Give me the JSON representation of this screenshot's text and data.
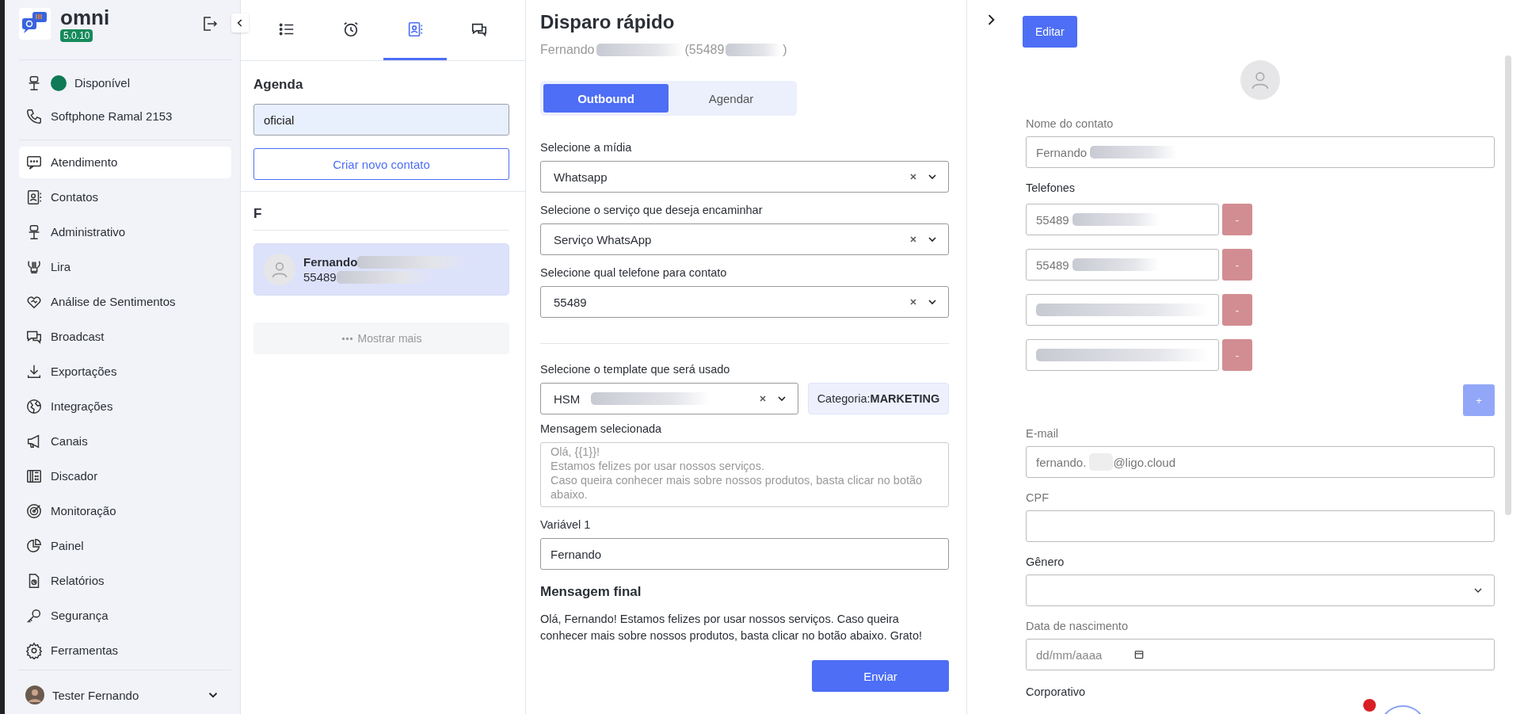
{
  "sidebar": {
    "app_name": "omni",
    "version": "5.0.10",
    "status": {
      "label": "Disponível",
      "color": "#0f7a55"
    },
    "softphone": "Softphone Ramal 2153",
    "nav": [
      {
        "label": "Atendimento",
        "selected": true
      },
      {
        "label": "Contatos",
        "selected": false
      },
      {
        "label": "Administrativo",
        "selected": false
      },
      {
        "label": "Lira",
        "selected": false
      },
      {
        "label": "Análise de Sentimentos",
        "selected": false
      },
      {
        "label": "Broadcast",
        "selected": false
      },
      {
        "label": "Exportações",
        "selected": false
      },
      {
        "label": "Integrações",
        "selected": false
      },
      {
        "label": "Canais",
        "selected": false
      },
      {
        "label": "Discador",
        "selected": false
      },
      {
        "label": "Monitoração",
        "selected": false
      },
      {
        "label": "Painel",
        "selected": false
      },
      {
        "label": "Relatórios",
        "selected": false
      },
      {
        "label": "Segurança",
        "selected": false
      },
      {
        "label": "Ferramentas",
        "selected": false
      }
    ],
    "user": {
      "name": "Tester Fernando"
    }
  },
  "contacts_panel": {
    "tabs": [
      {
        "selected": false
      },
      {
        "selected": false
      },
      {
        "selected": true
      },
      {
        "selected": false
      }
    ],
    "title": "Agenda",
    "search": {
      "value": "oficial"
    },
    "create_button": "Criar novo contato",
    "group": "F",
    "contacts": [
      {
        "name": "Fernando",
        "phone": "55489",
        "selected": true
      }
    ],
    "show_more": "Mostrar mais"
  },
  "quick_send": {
    "title": "Disparo rápido",
    "contact_name": "Fernando",
    "contact_phone_open": "(55489",
    "contact_phone_close": ")",
    "modes": [
      {
        "label": "Outbound",
        "selected": true
      },
      {
        "label": "Agendar",
        "selected": false
      }
    ],
    "selects": [
      {
        "label": "Selecione a mídia",
        "value": "Whatsapp"
      },
      {
        "label": "Selecione o serviço que deseja encaminhar",
        "value": "Serviço WhatsApp"
      },
      {
        "label": "Selecione qual telefone para contato",
        "value": "55489"
      }
    ],
    "template": {
      "label": "Selecione o template que será usado",
      "value": "HSM",
      "category": "Categoria:**MARKETING**"
    },
    "selected_message": {
      "label": "Mensagem selecionada",
      "lines": [
        "Olá, {{1}}!",
        "Estamos felizes por usar nossos serviços.",
        "Caso queira conhecer mais sobre nossos produtos, basta clicar no botão abaixo."
      ]
    },
    "variable": {
      "label": "Variável 1",
      "value": "Fernando"
    },
    "final_message": {
      "title": "Mensagem final",
      "text": "Olá, Fernando! Estamos felizes por usar nossos serviços. Caso queira conhecer mais sobre nossos produtos, basta clicar no botão abaixo. Grato!"
    },
    "send_button": "Enviar"
  },
  "contact_detail": {
    "edit_button": "Editar",
    "name": {
      "label": "Nome do contato",
      "value": "Fernando"
    },
    "phones_label": "Telefones",
    "phones": [
      {
        "value": "55489",
        "remove": "-",
        "disabled": true
      },
      {
        "value": "55489",
        "remove": "-",
        "disabled": true
      },
      {
        "remove": "-",
        "disabled": true
      },
      {
        "remove": "-",
        "disabled": true
      }
    ],
    "add_phone": {
      "label": "+",
      "disabled": true
    },
    "email": {
      "label": "E-mail",
      "value_start": "fernando.",
      "value_end": "@ligo.cloud"
    },
    "cpf": {
      "label": "CPF"
    },
    "gender": {
      "label": "Gênero"
    },
    "birth": {
      "label": "Data de nascimento",
      "placeholder": "dd/mm/aaaa"
    },
    "corporate": {
      "label": "Corporativo"
    }
  }
}
